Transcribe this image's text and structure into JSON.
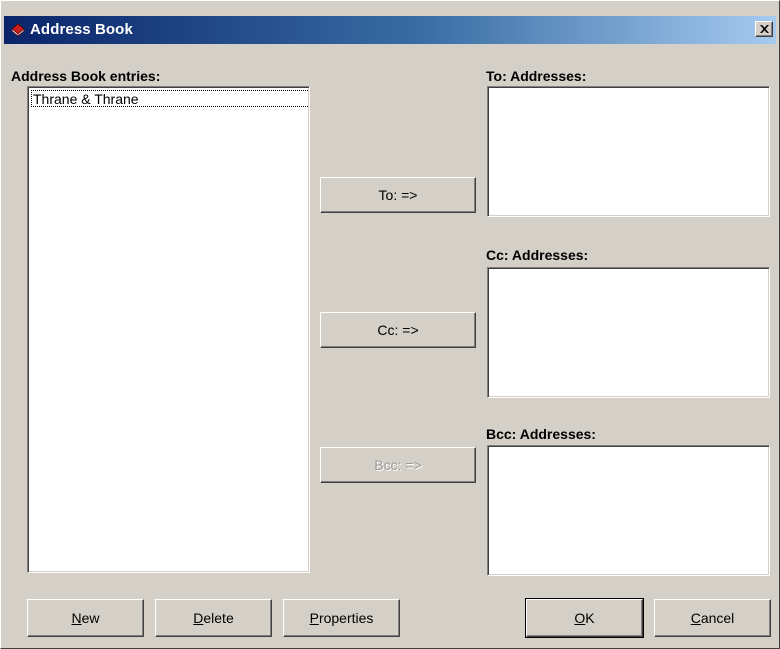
{
  "window": {
    "title": "Address Book",
    "close_glyph": "✕"
  },
  "labels": {
    "entries": "Address Book entries:",
    "to": "To: Addresses:",
    "cc": "Cc: Addresses:",
    "bcc": "Bcc: Addresses:"
  },
  "entries": {
    "items": [
      "Thrane & Thrane"
    ],
    "selected_index": 0
  },
  "transfer_buttons": {
    "to": "To: =>",
    "cc": "Cc: =>",
    "bcc": "Bcc: =>"
  },
  "actions": {
    "new_accel": "N",
    "new_rest": "ew",
    "delete_accel": "D",
    "delete_rest": "elete",
    "properties_accel": "P",
    "properties_rest": "roperties",
    "ok_accel": "O",
    "ok_rest": "K",
    "cancel_accel": "C",
    "cancel_rest": "ancel"
  },
  "colors": {
    "title_gradient_start": "#0a246a",
    "title_gradient_end": "#a6caf0",
    "face": "#d4d0c8",
    "disabled_text": "#9a9a9a"
  },
  "icons": {
    "app": "red-book-icon",
    "close": "close-icon"
  }
}
